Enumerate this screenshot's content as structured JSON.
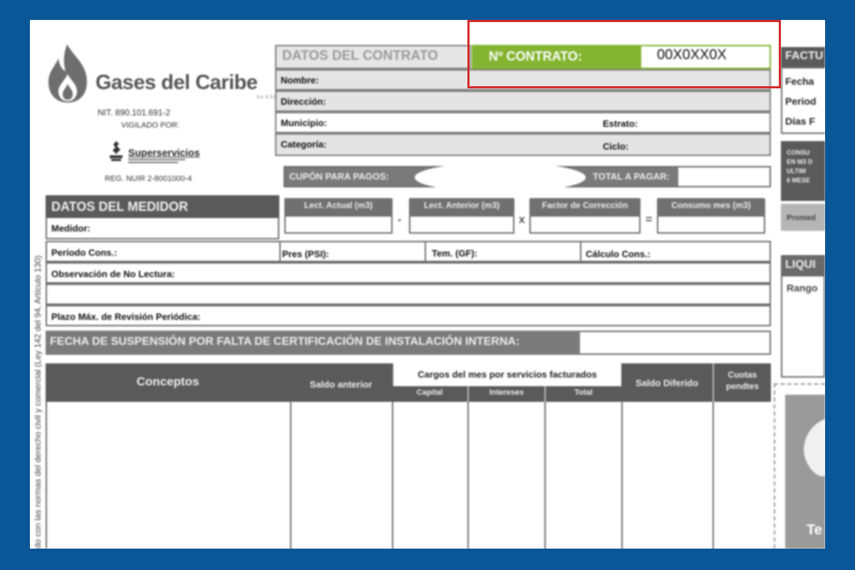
{
  "company": {
    "name": "Gases del Caribe",
    "suffix": "S.A. E.S.P.",
    "nit": "NIT. 890.101.691-2",
    "vigilado": "VIGILADO POR:",
    "supervisor": "Superservicios",
    "reg": "REG. NUIR 2-8001000-4"
  },
  "vertical_note": "do con las normas del derecho civil y comercial (Ley 142 del 94, Artículo 130)",
  "contract": {
    "title": "DATOS DEL CONTRATO",
    "number_label": "Nº CONTRATO:",
    "number_value": "00X0XX0X",
    "nombre": "Nombre:",
    "direccion": "Dirección:",
    "municipio": "Municipio:",
    "estrato": "Estrato:",
    "categoria": "Categoría:",
    "ciclo": "Ciclo:"
  },
  "factura": {
    "title": "FACTU",
    "fecha": "Fecha",
    "periodo": "Period",
    "dias": "Días F"
  },
  "cupon": {
    "label": "CUPÓN PARA PAGOS:",
    "total": "TOTAL A PAGAR:"
  },
  "medidor": {
    "title": "DATOS DEL MEDIDOR",
    "medidor": "Medidor:",
    "periodo": "Período Cons.:",
    "pres": "Pres (PSI):",
    "tem": "Tem. (GF):",
    "calculo": "Cálculo Cons.:",
    "observacion": "Observación de No Lectura:",
    "plazo": "Plazo Máx. de Revisión Periódica:"
  },
  "calc": {
    "actual": "Lect. Actual (m3)",
    "anterior": "Lect. Anterior (m3)",
    "factor": "Factor de Corrección",
    "consumo": "Consumo mes (m3)",
    "minus": "-",
    "times": "x",
    "equals": "="
  },
  "suspension": "FECHA DE SUSPENSIÓN POR FALTA DE CERTIFICACIÓN DE INSTALACIÓN INTERNA:",
  "table": {
    "conceptos": "Conceptos",
    "saldo_anterior": "Saldo anterior",
    "cargos": "Cargos del mes por servicios facturados",
    "capital": "Capital",
    "intereses": "Intereses",
    "total": "Total",
    "saldo_diferido": "Saldo Diferido",
    "cuotas_1": "Cuotas",
    "cuotas_2": "pendtes"
  },
  "right": {
    "consumo_lines": [
      "CONSU",
      "EN M3 D",
      "ULTIM",
      "6 MESE"
    ],
    "promedio": "Promed",
    "liquidacion": "LIQUI",
    "rango": "Rango",
    "promo": "Te"
  },
  "colors": {
    "page_background": "#0a5697",
    "accent_green": "#84b431",
    "highlight_red": "#d42a2a"
  }
}
